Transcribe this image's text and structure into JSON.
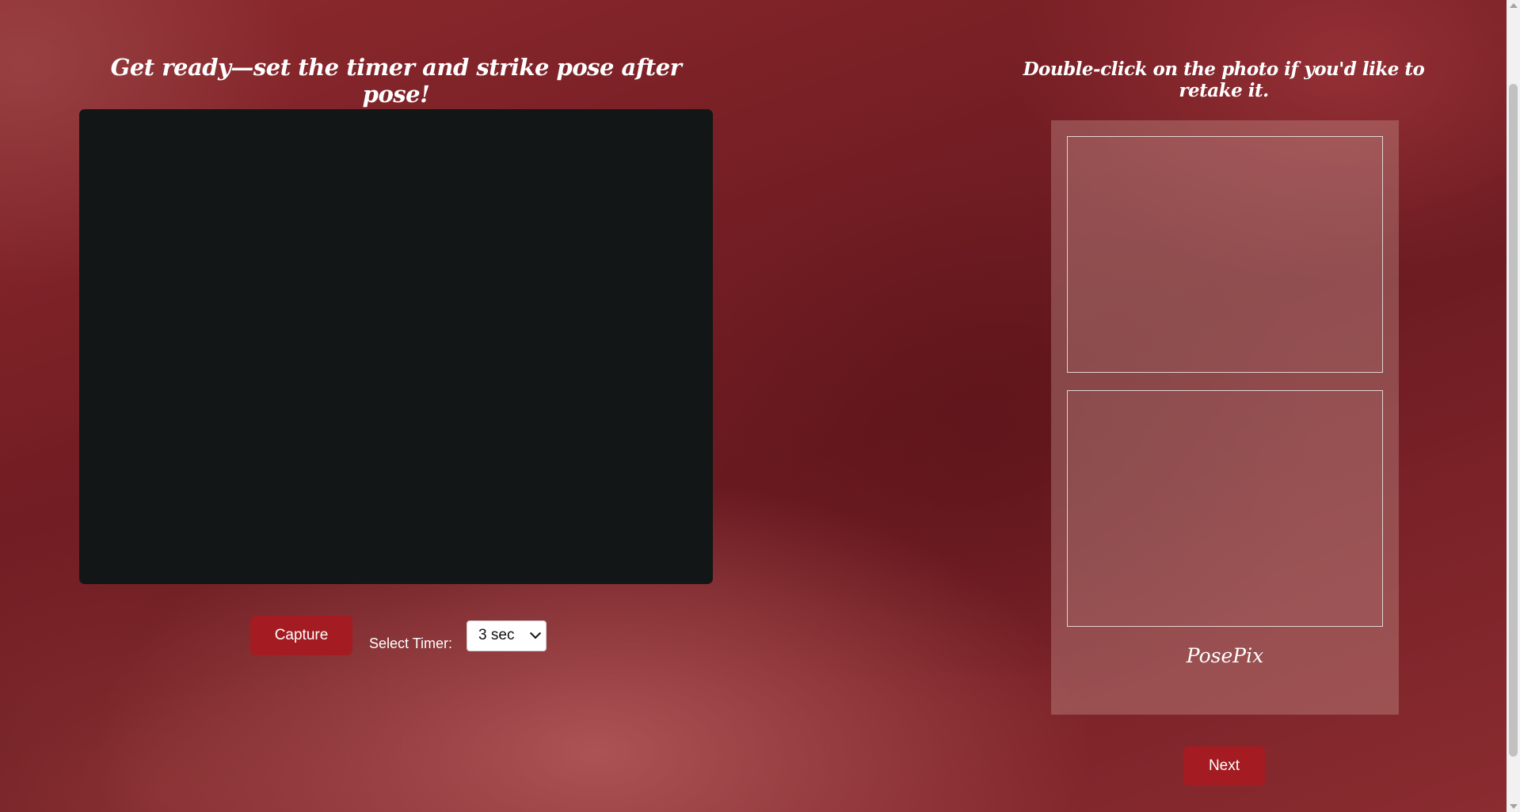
{
  "instructions": {
    "left_heading": "Get ready—set the timer and strike pose after pose!",
    "right_heading": "Double-click on the photo if you'd like to retake it."
  },
  "controls": {
    "capture_label": "Capture",
    "timer_label": "Select Timer:",
    "timer_value": "3 sec"
  },
  "photo_strip": {
    "brand": "PosePix",
    "slots": [
      "empty",
      "empty"
    ]
  },
  "next_label": "Next",
  "colors": {
    "button": "#a41c21",
    "camera_bg": "#131616"
  }
}
